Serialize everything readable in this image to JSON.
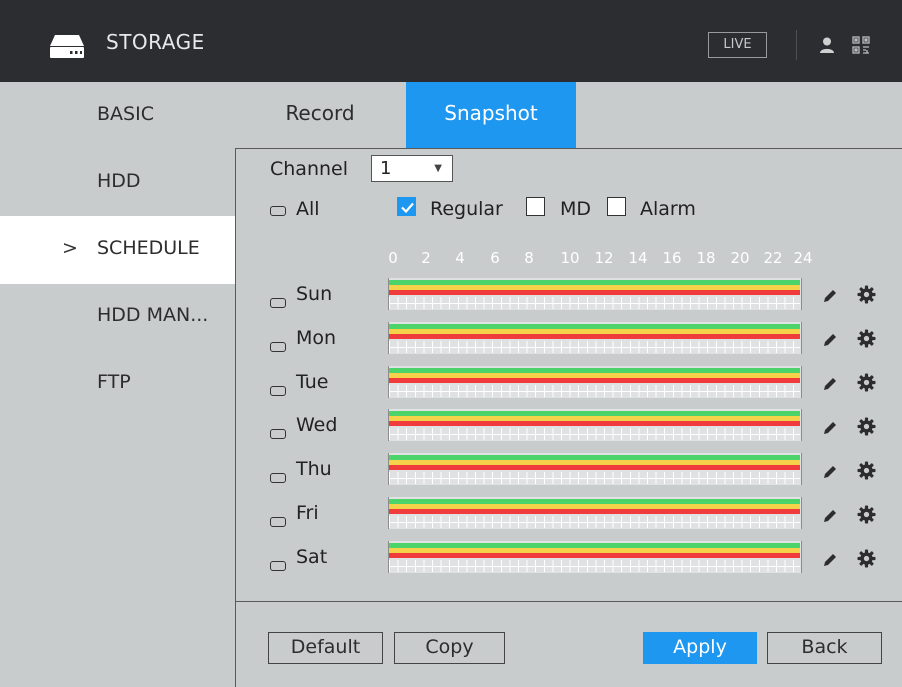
{
  "header": {
    "title": "STORAGE",
    "live_label": "LIVE",
    "icons": [
      "storage-icon",
      "user-icon",
      "qr-code-icon"
    ]
  },
  "sidebar": {
    "items": [
      {
        "label": "BASIC"
      },
      {
        "label": "HDD"
      },
      {
        "label": "SCHEDULE",
        "active": true
      },
      {
        "label": "HDD MAN..."
      },
      {
        "label": "FTP"
      }
    ],
    "active_marker": ">"
  },
  "tabs": [
    {
      "label": "Record"
    },
    {
      "label": "Snapshot",
      "active": true
    }
  ],
  "schedule": {
    "channel_label": "Channel",
    "channel_value": "1",
    "all_label": "All",
    "types": [
      {
        "label": "Regular",
        "checked": true
      },
      {
        "label": "MD",
        "checked": false
      },
      {
        "label": "Alarm",
        "checked": false
      }
    ],
    "hour_ticks": [
      "0",
      "2",
      "4",
      "6",
      "8",
      "10",
      "12",
      "14",
      "16",
      "18",
      "20",
      "22",
      "24"
    ],
    "days": [
      "Sun",
      "Mon",
      "Tue",
      "Wed",
      "Thu",
      "Fri",
      "Sat"
    ],
    "bar_colors": {
      "green": "#4cd46a",
      "yellow": "#f6d24a",
      "red": "#ef3b3b"
    }
  },
  "buttons": {
    "default_label": "Default",
    "copy_label": "Copy",
    "apply_label": "Apply",
    "back_label": "Back"
  },
  "colors": {
    "accent": "#1e97f1",
    "header_bg": "#2b2d31",
    "panel_bg": "#c9cccd"
  }
}
